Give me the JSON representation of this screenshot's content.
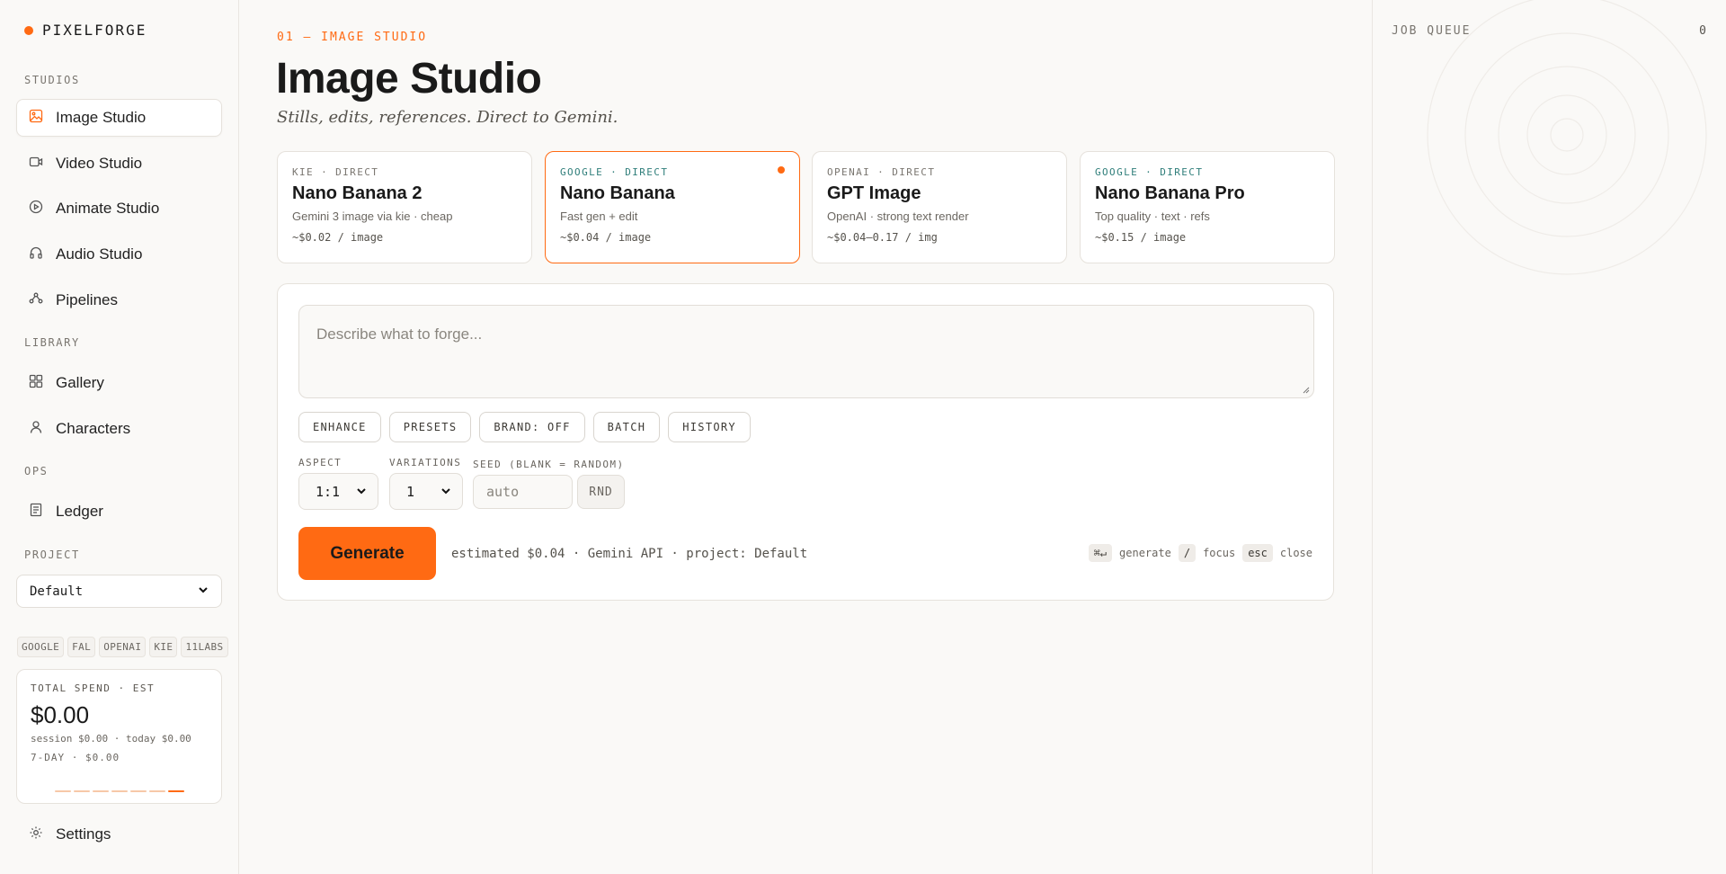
{
  "brand": {
    "name": "PIXELFORGE",
    "accent": "#ff6a13"
  },
  "sidebar": {
    "sections": {
      "studios": "STUDIOS",
      "library": "LIBRARY",
      "ops": "OPS",
      "project": "PROJECT"
    },
    "studios": [
      {
        "label": "Image Studio",
        "icon": "image-icon",
        "active": true
      },
      {
        "label": "Video Studio",
        "icon": "video-icon"
      },
      {
        "label": "Animate Studio",
        "icon": "play-circle-icon"
      },
      {
        "label": "Audio Studio",
        "icon": "headphones-icon"
      },
      {
        "label": "Pipelines",
        "icon": "nodes-icon"
      }
    ],
    "library": [
      {
        "label": "Gallery",
        "icon": "grid-icon"
      },
      {
        "label": "Characters",
        "icon": "user-icon"
      }
    ],
    "ops": [
      {
        "label": "Ledger",
        "icon": "ledger-icon"
      }
    ],
    "project_select": "Default",
    "providers": [
      "GOOGLE",
      "FAL",
      "OPENAI",
      "KIE",
      "11LABS"
    ],
    "spend": {
      "label": "TOTAL SPEND · EST",
      "amount": "$0.00",
      "sub": "session $0.00 · today $0.00",
      "week": "7-DAY · $0.00"
    },
    "settings": {
      "label": "Settings",
      "icon": "gear-icon"
    }
  },
  "main": {
    "eyebrow": "01 — IMAGE STUDIO",
    "title": "Image Studio",
    "subtitle": "Stills, edits, references. Direct to Gemini.",
    "models": [
      {
        "tag": "KIE · DIRECT",
        "name": "Nano Banana 2",
        "desc": "Gemini 3 image via kie · cheap",
        "price": "~$0.02 / image",
        "selected": false
      },
      {
        "tag": "GOOGLE · DIRECT",
        "name": "Nano Banana",
        "desc": "Fast gen + edit",
        "price": "~$0.04 / image",
        "selected": true
      },
      {
        "tag": "OPENAI · DIRECT",
        "name": "GPT Image",
        "desc": "OpenAI · strong text render",
        "price": "~$0.04–0.17 / img",
        "selected": false
      },
      {
        "tag": "GOOGLE · DIRECT",
        "name": "Nano Banana Pro",
        "desc": "Top quality · text · refs",
        "price": "~$0.15 / image",
        "selected": false
      }
    ],
    "composer": {
      "placeholder": "Describe what to forge...",
      "chips": [
        "ENHANCE",
        "PRESETS",
        "BRAND: OFF",
        "BATCH",
        "HISTORY"
      ],
      "aspect_label": "ASPECT",
      "aspect_value": "1:1",
      "variations_label": "VARIATIONS",
      "variations_value": "1",
      "seed_label": "SEED (BLANK = RANDOM)",
      "seed_placeholder": "auto",
      "rnd_label": "RND",
      "generate_label": "Generate",
      "estimate": "estimated $0.04 · Gemini API · project: Default",
      "shortcuts": {
        "k1": "⌘↵",
        "t1": "generate",
        "k2": "/",
        "t2": "focus",
        "k3": "esc",
        "t3": "close"
      }
    }
  },
  "queue": {
    "title": "JOB QUEUE",
    "count": "0"
  }
}
